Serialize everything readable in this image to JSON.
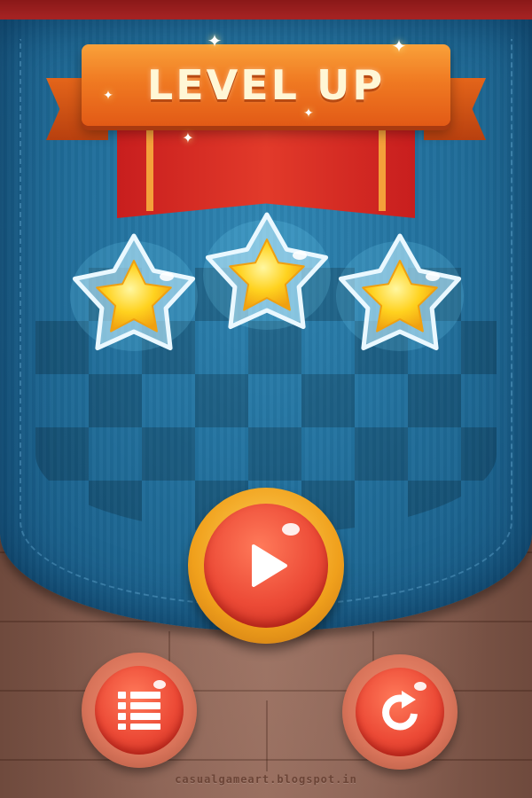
{
  "screen": {
    "title": "LEVEL UP",
    "stars_earned": 3,
    "stars_total": 3
  },
  "buttons": {
    "play": {
      "icon": "play-icon"
    },
    "menu": {
      "icon": "level-list-icon"
    },
    "replay": {
      "icon": "replay-icon"
    }
  },
  "watermark": "casualgameart.blogspot.in",
  "colors": {
    "banner": "#f07a22",
    "ribbon_red": "#e23a2a",
    "pocket_blue": "#2373a0",
    "wood": "#8a6153",
    "button_red": "#ec4a36",
    "button_gold": "#f0a01c",
    "star_gold": "#ffd21f"
  }
}
